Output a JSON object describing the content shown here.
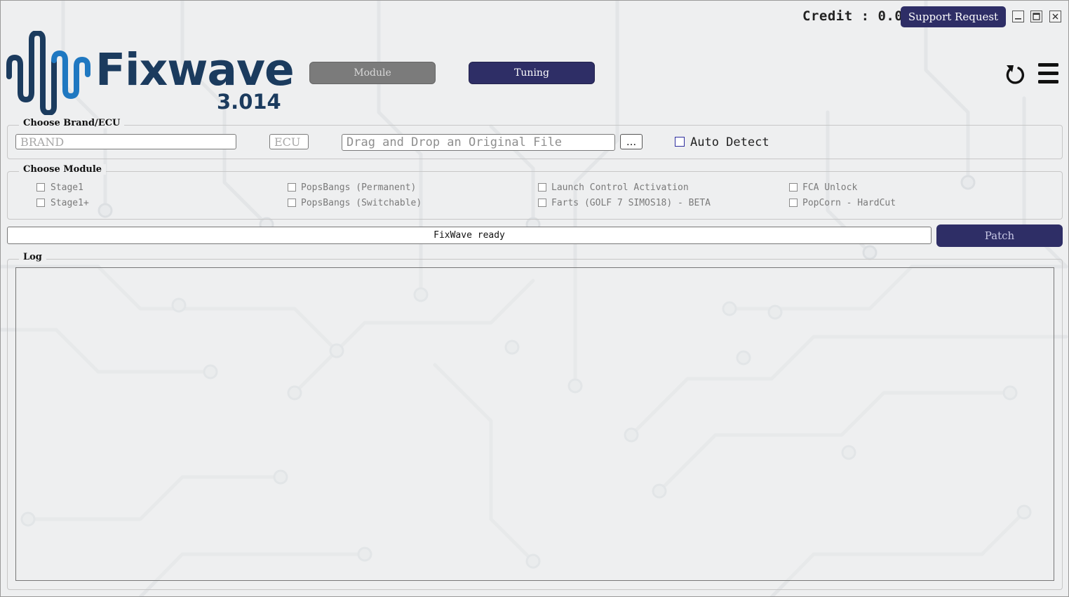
{
  "header": {
    "credit": "Credit : 0.0",
    "support_label": "Support Request"
  },
  "logo": {
    "name": "Fixwave",
    "version": "3.014"
  },
  "modes": {
    "module_label": "Module",
    "tuning_label": "Tuning"
  },
  "brand_ecu": {
    "title": "Choose Brand/ECU",
    "brand_placeholder": "BRAND",
    "ecu_placeholder": "ECU",
    "file_placeholder": "Drag and Drop an Original File",
    "browse_label": "...",
    "auto_detect_label": "Auto Detect"
  },
  "module": {
    "title": "Choose Module",
    "options": [
      "Stage1",
      "Stage1+",
      "PopsBangs (Permanent)",
      "PopsBangs (Switchable)",
      "Launch Control Activation",
      "Farts (GOLF 7 SIMOS18) - BETA",
      "FCA Unlock",
      "PopCorn - HardCut"
    ]
  },
  "status": {
    "text": "FixWave ready",
    "patch_label": "Patch"
  },
  "log": {
    "title": "Log"
  },
  "colors": {
    "accent": "#2e2e66",
    "logo_dark": "#1b3b5e",
    "logo_light": "#1f78c1"
  },
  "icons": [
    "minimize-icon",
    "maximize-icon",
    "close-icon",
    "reset-icon",
    "hamburger-menu-icon"
  ]
}
